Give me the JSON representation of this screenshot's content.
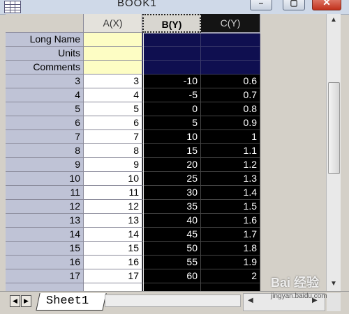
{
  "window": {
    "title": "BOOK1",
    "min_label": "–",
    "max_label": "▢",
    "close_label": "✕"
  },
  "columns": [
    {
      "label": "",
      "style": "corner"
    },
    {
      "label": "A(X)",
      "style": "normal"
    },
    {
      "label": "B(Y)",
      "style": "selected"
    },
    {
      "label": "C(Y)",
      "style": "dark"
    }
  ],
  "label_rows": [
    "Long Name",
    "Units",
    "Comments"
  ],
  "rows": [
    {
      "n": "3",
      "a": "3",
      "b": "-10",
      "c": "0.6"
    },
    {
      "n": "4",
      "a": "4",
      "b": "-5",
      "c": "0.7"
    },
    {
      "n": "5",
      "a": "5",
      "b": "0",
      "c": "0.8"
    },
    {
      "n": "6",
      "a": "6",
      "b": "5",
      "c": "0.9"
    },
    {
      "n": "7",
      "a": "7",
      "b": "10",
      "c": "1"
    },
    {
      "n": "8",
      "a": "8",
      "b": "15",
      "c": "1.1"
    },
    {
      "n": "9",
      "a": "9",
      "b": "20",
      "c": "1.2"
    },
    {
      "n": "10",
      "a": "10",
      "b": "25",
      "c": "1.3"
    },
    {
      "n": "11",
      "a": "11",
      "b": "30",
      "c": "1.4"
    },
    {
      "n": "12",
      "a": "12",
      "b": "35",
      "c": "1.5"
    },
    {
      "n": "13",
      "a": "13",
      "b": "40",
      "c": "1.6"
    },
    {
      "n": "14",
      "a": "14",
      "b": "45",
      "c": "1.7"
    },
    {
      "n": "15",
      "a": "15",
      "b": "50",
      "c": "1.8"
    },
    {
      "n": "16",
      "a": "16",
      "b": "55",
      "c": "1.9"
    },
    {
      "n": "17",
      "a": "17",
      "b": "60",
      "c": "2"
    }
  ],
  "sheet_tabs": {
    "active": "Sheet1",
    "prev_label": "◀",
    "next_label": "▶"
  },
  "scroll": {
    "up": "▲",
    "down": "▼",
    "left": "◀",
    "right": "▶"
  },
  "watermark": {
    "brand": "Bai 经验",
    "url": "jingyan.baidu.com"
  },
  "colors": {
    "selected_fill": "#000000",
    "label_fill_selected": "#0f0f50",
    "label_fill_x": "#fdfdc4",
    "row_header": "#bfc3d6"
  }
}
